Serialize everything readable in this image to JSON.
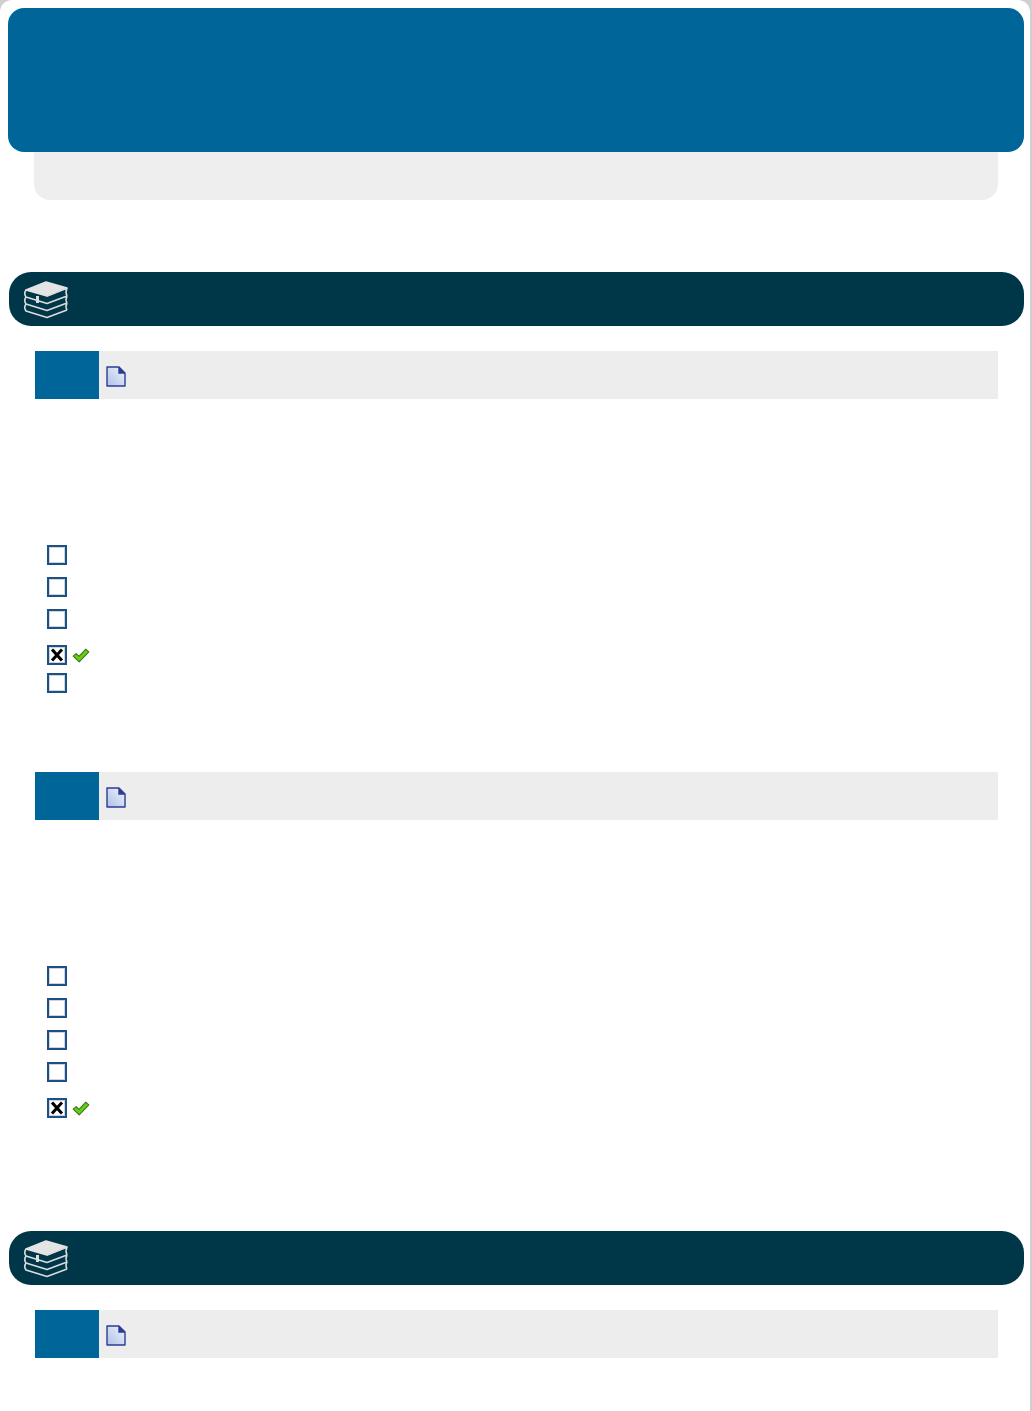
{
  "items": [
    {
      "kind": "section"
    },
    {
      "kind": "question"
    },
    {
      "kind": "option",
      "checked": false,
      "correct": false
    },
    {
      "kind": "option",
      "checked": false,
      "correct": false
    },
    {
      "kind": "option",
      "checked": false,
      "correct": false
    },
    {
      "kind": "option",
      "checked": true,
      "correct": true
    },
    {
      "kind": "option",
      "checked": false,
      "correct": false
    },
    {
      "kind": "question"
    },
    {
      "kind": "option",
      "checked": false,
      "correct": false
    },
    {
      "kind": "option",
      "checked": false,
      "correct": false
    },
    {
      "kind": "option",
      "checked": false,
      "correct": false
    },
    {
      "kind": "option",
      "checked": false,
      "correct": false
    },
    {
      "kind": "option",
      "checked": true,
      "correct": true
    },
    {
      "kind": "section"
    },
    {
      "kind": "question"
    }
  ]
}
